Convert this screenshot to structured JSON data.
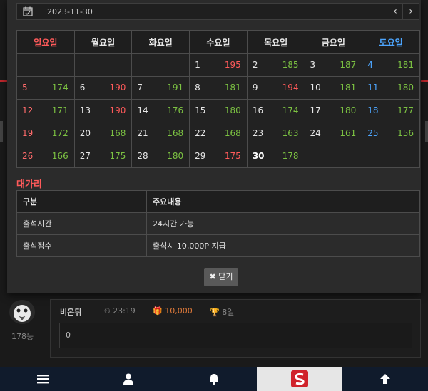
{
  "date_bar": {
    "value": "2023-11-30"
  },
  "calendar": {
    "weekdays": [
      "일요일",
      "월요일",
      "화요일",
      "수요일",
      "목요일",
      "금요일",
      "토요일"
    ],
    "rows": [
      [
        "",
        "",
        "",
        "1|195",
        "2|185",
        "3|187",
        "4|181"
      ],
      [
        "5|174",
        "6|190",
        "7|191",
        "8|181",
        "9|194",
        "10|181",
        "11|180"
      ],
      [
        "12|171",
        "13|190",
        "14|176",
        "15|180",
        "16|174",
        "17|180",
        "18|177"
      ],
      [
        "19|172",
        "20|168",
        "21|168",
        "22|168",
        "23|163",
        "24|161",
        "25|156"
      ],
      [
        "26|166",
        "27|175",
        "28|180",
        "29|175",
        "30|178",
        "",
        ""
      ]
    ],
    "colors": {
      "green": "#7cc242",
      "red": "#ff5a5a",
      "blue": "#4da6ff"
    }
  },
  "section": {
    "title": "대가리"
  },
  "info_table": {
    "headers": [
      "구분",
      "주요내용"
    ],
    "rows": [
      [
        "출석시간",
        "24시간 가능"
      ],
      [
        "출석점수",
        "출석시 10,000P 지급"
      ]
    ]
  },
  "close_button": {
    "label": "닫기"
  },
  "background": {
    "rank": "178등",
    "comment": {
      "name": "비온뒤",
      "time": "23:19",
      "point": "10,000",
      "days": "8일",
      "text": "0"
    }
  },
  "bottom_nav": {
    "icons": [
      "menu-icon",
      "user-icon",
      "bell-icon",
      "site-logo",
      "arrow-up-icon"
    ]
  }
}
